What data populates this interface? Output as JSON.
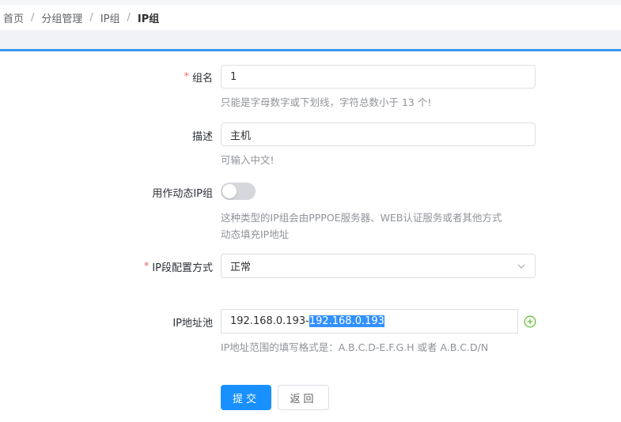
{
  "breadcrumb": [
    "首页",
    "分组管理",
    "IP组",
    "IP组"
  ],
  "breadcrumb_sep": "/",
  "form": {
    "group_name": {
      "required": true,
      "label": "组名",
      "value": "1",
      "hint": "只能是字母数字或下划线，字符总数小于 13 个!"
    },
    "description": {
      "label": "描述",
      "value": "主机",
      "hint": "可输入中文!"
    },
    "dynamic": {
      "label": "用作动态IP组",
      "enabled": false,
      "hint_line1": "这种类型的IP组会由PPPOE服务器、WEB认证服务或者其他方式",
      "hint_line2": "动态填充IP地址"
    },
    "ip_config": {
      "required": true,
      "label": "IP段配置方式",
      "selected": "正常"
    },
    "ip_pool": {
      "label": "IP地址池",
      "value_plain": "192.168.0.193-",
      "value_selected": "192.168.0.193",
      "hint": "IP地址范围的填写格式是：A.B.C.D-E.F.G.H 或者 A.B.C.D/N"
    }
  },
  "buttons": {
    "submit": "提交",
    "back": "返回"
  },
  "colors": {
    "primary": "#1890ff",
    "accent_line": "#3a98f2",
    "required": "#f56c6c",
    "add_icon": "#67c23a",
    "selection": "#3390ff"
  },
  "icons": {
    "select_arrow": "chevron-down-icon",
    "add": "plus-circle-icon"
  }
}
